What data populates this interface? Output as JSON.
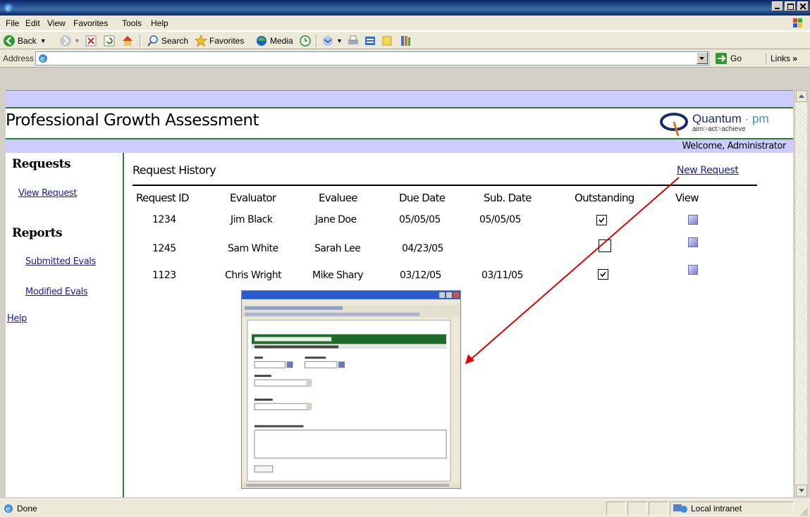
{
  "menu": [
    "File",
    "Edit",
    "View",
    "Favorites",
    "Tools",
    "Help"
  ],
  "toolbar": {
    "back": "Back",
    "search": "Search",
    "favorites": "Favorites",
    "media": "Media"
  },
  "address": {
    "label": "Address",
    "value": "",
    "go": "Go",
    "links": "Links"
  },
  "page": {
    "title": "Professional Growth Assessment",
    "logo_brand": "Quantum",
    "logo_pm": "pm",
    "logo_tag_aim": "aim",
    "logo_tag_act": "act",
    "logo_tag_achieve": "achieve",
    "welcome": "Welcome, Administrator"
  },
  "sidebar": {
    "requests_heading": "Requests",
    "view_request": "View Request",
    "reports_heading": "Reports",
    "submitted_evals": "Submitted Evals",
    "modified_evals": "Modified Evals",
    "help": "Help"
  },
  "history": {
    "title": "Request History",
    "new_request": "New Request",
    "columns": [
      "Request ID",
      "Evaluator",
      "Evaluee",
      "Due Date",
      "Sub. Date",
      "Outstanding",
      "View"
    ],
    "rows": [
      {
        "id": "1234",
        "evaluator": "Jim Black",
        "evaluee": "Jane Doe",
        "due": "05/05/05",
        "sub": "05/05/05",
        "outstanding": true
      },
      {
        "id": "1245",
        "evaluator": "Sam White",
        "evaluee": "Sarah Lee",
        "due": "04/23/05",
        "sub": "",
        "outstanding": false
      },
      {
        "id": "1123",
        "evaluator": "Chris Wright",
        "evaluee": "Mike Shary",
        "due": "03/12/05",
        "sub": "03/11/05",
        "outstanding": true
      }
    ]
  },
  "status": {
    "done": "Done",
    "zone": "Local intranet"
  },
  "colors": {
    "accent_green": "#2e7d32",
    "band_lavender": "#ccccff",
    "link_blue": "#1a1aa6",
    "arrow_red": "#e00000"
  }
}
